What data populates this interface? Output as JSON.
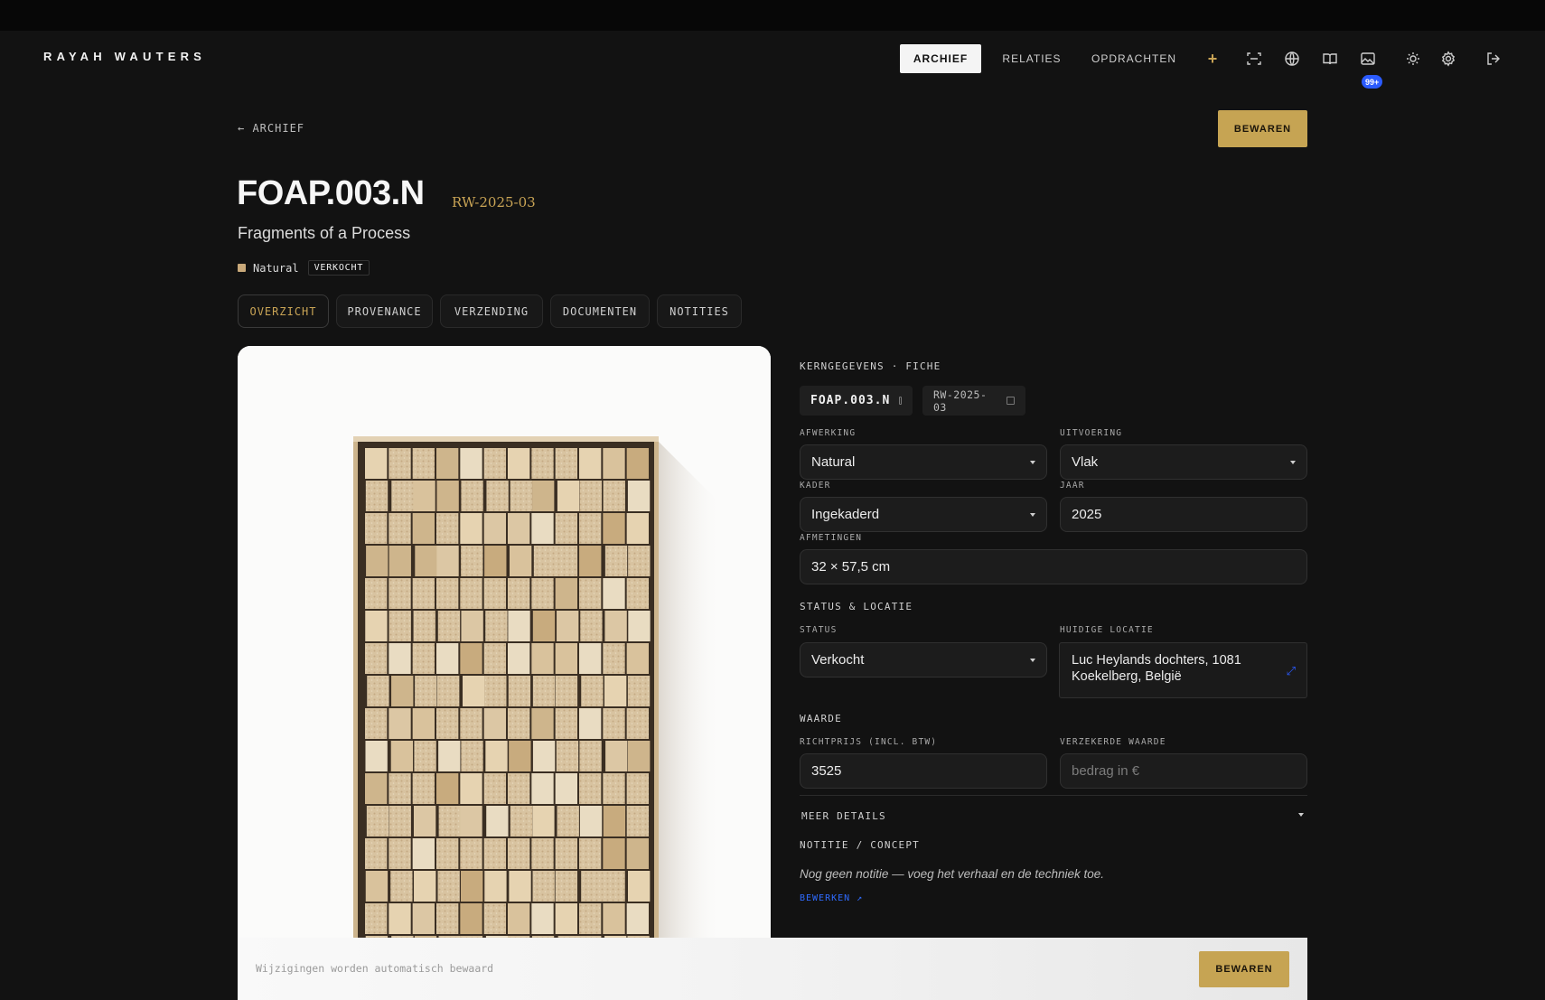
{
  "brand": "RAYAH WAUTERS",
  "nav": {
    "tabs": [
      {
        "label": "ARCHIEF",
        "active": true
      },
      {
        "label": "RELATIES",
        "active": false
      },
      {
        "label": "OPDRACHTEN",
        "active": false
      }
    ],
    "add_label": "+",
    "icons": [
      "scan-icon",
      "globe-icon",
      "book-icon",
      "image-icon",
      "sun-icon",
      "gear-icon",
      "logout-icon"
    ],
    "badge": "99+"
  },
  "back_label": "← ARCHIEF",
  "save_label": "BEWAREN",
  "artwork": {
    "title": "FOAP.003.N",
    "code": "RW-2025-03",
    "subtitle": "Fragments of a Process",
    "finish_tag": "Natural",
    "status_tag": "VERKOCHT",
    "swatch_color": "#c9a97a"
  },
  "tabs": [
    {
      "label": "OVERZICHT",
      "active": true
    },
    {
      "label": "PROVENANCE",
      "active": false
    },
    {
      "label": "VERZENDING",
      "active": false
    },
    {
      "label": "DOCUMENTEN",
      "active": false
    },
    {
      "label": "NOTITIES",
      "active": false
    }
  ],
  "panel": {
    "section_core": "KERNGEGEVENS · FICHE",
    "chip_title": "FOAP.003.N",
    "chip_code": "RW-2025-03",
    "afwerking": {
      "label": "AFWERKING",
      "value": "Natural"
    },
    "uitvoering": {
      "label": "UITVOERING",
      "value": "Vlak"
    },
    "kader": {
      "label": "KADER",
      "value": "Ingekaderd"
    },
    "jaar": {
      "label": "JAAR",
      "value": "2025"
    },
    "afmetingen": {
      "label": "AFMETINGEN",
      "value": "32 × 57,5 cm"
    },
    "section_status": "STATUS & LOCATIE",
    "status": {
      "label": "STATUS",
      "value": "Verkocht"
    },
    "locatie": {
      "label": "HUIDIGE LOCATIE",
      "value": "Luc Heylands dochters, 1081 Koekelberg, België"
    },
    "section_value": "WAARDE",
    "richtprijs": {
      "label": "RICHTPRIJS (INCL. BTW)",
      "value": "3525"
    },
    "verzekerd": {
      "label": "VERZEKERDE WAARDE",
      "placeholder": "bedrag in €"
    },
    "more_details": "MEER DETAILS",
    "note_label": "NOTITIE / CONCEPT",
    "note_text": "Nog geen notitie — voeg het verhaal en de techniek toe.",
    "edit_link": "BEWERKEN ↗"
  },
  "footer": {
    "note": "Wijzigingen worden automatisch bewaard",
    "save_label": "BEWAREN"
  },
  "colors": {
    "accent_gold": "#c6a453",
    "link_blue": "#2f6bff",
    "background": "#121212"
  }
}
